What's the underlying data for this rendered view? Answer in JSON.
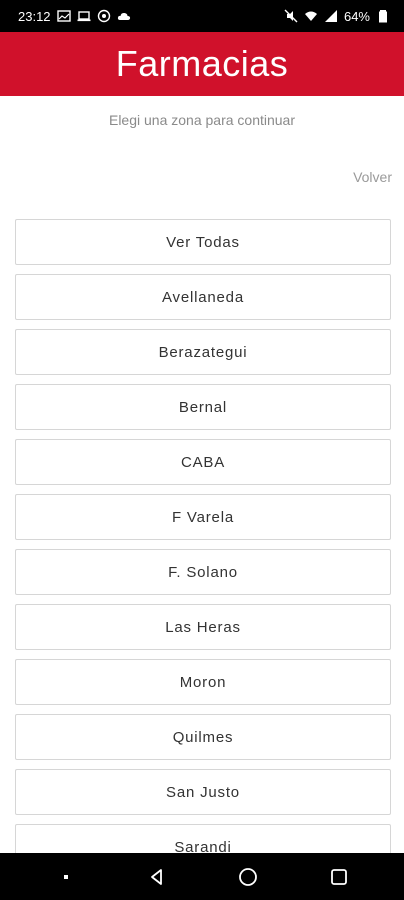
{
  "status_bar": {
    "time": "23:12",
    "battery": "64%"
  },
  "header": {
    "title": "Farmacias"
  },
  "subtitle": "Elegi una zona para continuar",
  "back_label": "Volver",
  "zones": [
    "Ver Todas",
    "Avellaneda",
    "Berazategui",
    "Bernal",
    "CABA",
    "F Varela",
    "F. Solano",
    "Las Heras",
    "Moron",
    "Quilmes",
    "San Justo",
    "Sarandi"
  ],
  "colors": {
    "brand": "#d0112b",
    "text": "#333333",
    "muted": "#8a8a8a",
    "border": "#d6d6d6"
  },
  "icons": {
    "status_left": [
      "gallery-icon",
      "laptop-icon",
      "shield-icon",
      "cloud-icon"
    ],
    "status_right": [
      "mute-icon",
      "wifi-icon",
      "signal-icon",
      "battery-icon"
    ],
    "nav": [
      "menu-dot-icon",
      "back-triangle-icon",
      "home-circle-icon",
      "recents-square-icon"
    ]
  }
}
